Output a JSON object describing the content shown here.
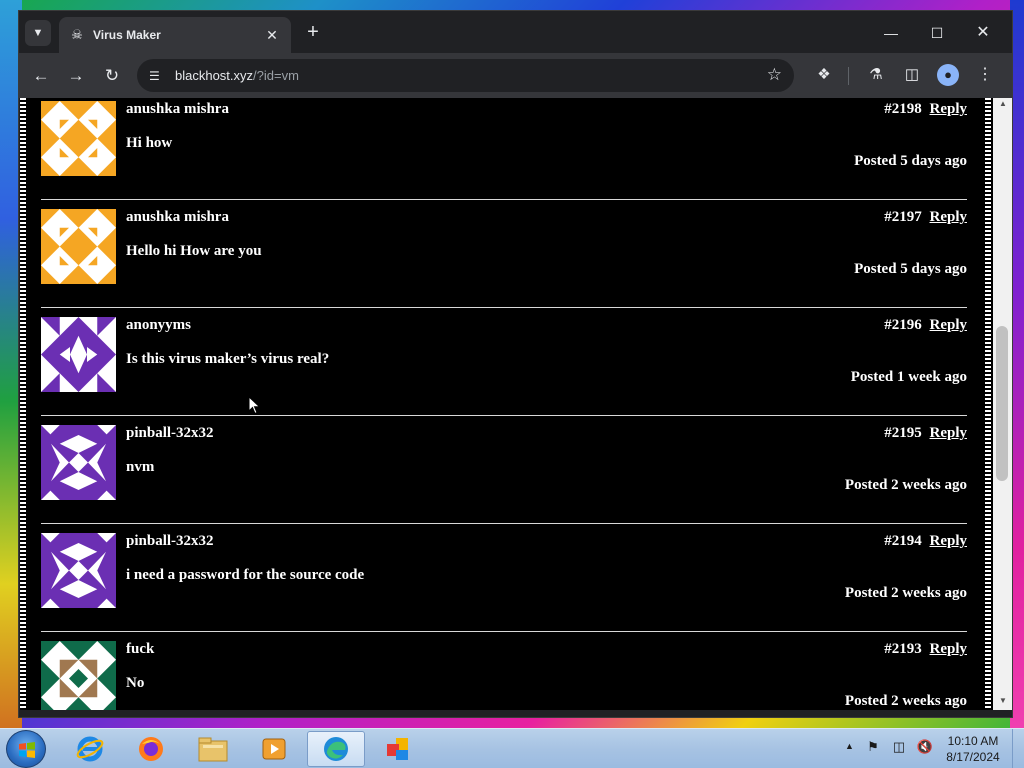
{
  "browser": {
    "tab": {
      "title": "Virus Maker",
      "favicon": "pirate-flag-icon"
    },
    "url": {
      "host": "blackhost.xyz",
      "path": "/?id=vm"
    }
  },
  "comments": [
    {
      "id": "#2198",
      "author": "anushka mishra",
      "text": "Hi how",
      "reply_label": "Reply",
      "posted": "Posted 5 days ago",
      "avatar": {
        "color": "#f5a623",
        "pattern": "orange"
      }
    },
    {
      "id": "#2197",
      "author": "anushka mishra",
      "text": "Hello hi How are you",
      "reply_label": "Reply",
      "posted": "Posted 5 days ago",
      "avatar": {
        "color": "#f5a623",
        "pattern": "orange"
      }
    },
    {
      "id": "#2196",
      "author": "anonyyms",
      "text": "Is this virus maker’s virus real?",
      "reply_label": "Reply",
      "posted": "Posted 1 week ago",
      "avatar": {
        "color": "#6b2fb3",
        "pattern": "purple-a"
      }
    },
    {
      "id": "#2195",
      "author": "pinball-32x32",
      "text": "nvm",
      "reply_label": "Reply",
      "posted": "Posted 2 weeks ago",
      "avatar": {
        "color": "#6b2fb3",
        "pattern": "purple-b"
      }
    },
    {
      "id": "#2194",
      "author": "pinball-32x32",
      "text": "i need a password for the source code",
      "reply_label": "Reply",
      "posted": "Posted 2 weeks ago",
      "avatar": {
        "color": "#6b2fb3",
        "pattern": "purple-b"
      }
    },
    {
      "id": "#2193",
      "author": "fuck",
      "text": "No",
      "reply_label": "Reply",
      "posted": "Posted 2 weeks ago",
      "avatar": {
        "color": "#0f6b4a",
        "pattern": "green"
      }
    }
  ],
  "taskbar": {
    "apps": [
      "internet-explorer-icon",
      "firefox-icon",
      "file-explorer-icon",
      "media-player-icon",
      "edge-icon",
      "office-icon"
    ],
    "active_app": "edge-icon"
  },
  "clock": {
    "time": "10:10 AM",
    "date": "8/17/2024"
  },
  "colors": {
    "page_bg": "#000000",
    "text": "#ffffff",
    "avatar_orange": "#f5a623",
    "avatar_purple": "#6b2fb3",
    "avatar_green": "#0f6b4a",
    "avatar_brown": "#a07850"
  }
}
